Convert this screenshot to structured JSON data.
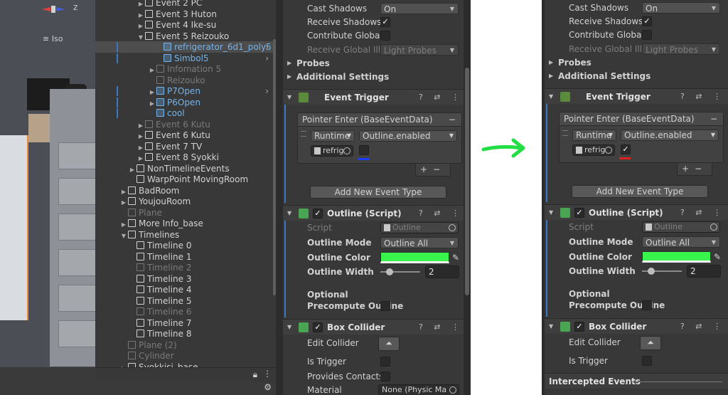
{
  "scene": {
    "gizmo_label": "z",
    "view_mode": "Iso"
  },
  "hierarchy": {
    "rows": [
      {
        "label": "Event 2 PC",
        "state": "normal"
      },
      {
        "label": "Event 3 Huton",
        "state": "normal"
      },
      {
        "label": "Event 4 Ike-su",
        "state": "normal"
      },
      {
        "label": "Event 5 Reizouko",
        "state": "normal"
      },
      {
        "label": "refrigerator_6d1_poly5",
        "state": "selected"
      },
      {
        "label": "Simbol5",
        "state": "blue"
      },
      {
        "label": "Infomation 5",
        "state": "dim"
      },
      {
        "label": "Reizouko",
        "state": "dim"
      },
      {
        "label": "P7Open",
        "state": "blue"
      },
      {
        "label": "P6Open",
        "state": "blue"
      },
      {
        "label": "cool",
        "state": "blue"
      },
      {
        "label": "Event 6 Kutu",
        "state": "dim"
      },
      {
        "label": "Event 6 Kutu",
        "state": "normal"
      },
      {
        "label": "Event 7 TV",
        "state": "normal"
      },
      {
        "label": "Event 8 Syokki",
        "state": "normal"
      },
      {
        "label": "NonTimelineEvents",
        "state": "normal"
      },
      {
        "label": "WarpPoint MovingRoom",
        "state": "normal"
      },
      {
        "label": "BadRoom",
        "state": "normal"
      },
      {
        "label": "YoujouRoom",
        "state": "normal"
      },
      {
        "label": "Plane",
        "state": "dim"
      },
      {
        "label": "More Info_base",
        "state": "normal"
      },
      {
        "label": "Timelines",
        "state": "normal"
      },
      {
        "label": "Timeline 0",
        "state": "normal"
      },
      {
        "label": "Timeline 1",
        "state": "normal"
      },
      {
        "label": "Timeline 2",
        "state": "dim"
      },
      {
        "label": "Timeline 3",
        "state": "normal"
      },
      {
        "label": "Timeline 4",
        "state": "normal"
      },
      {
        "label": "Timeline 5",
        "state": "normal"
      },
      {
        "label": "Timeline 6",
        "state": "dim"
      },
      {
        "label": "Timeline 7",
        "state": "normal"
      },
      {
        "label": "Timeline 8",
        "state": "normal"
      },
      {
        "label": "Plane (2)",
        "state": "dim"
      },
      {
        "label": "Cylinder",
        "state": "dim"
      },
      {
        "label": "Syokkisi_base",
        "state": "normal"
      }
    ]
  },
  "inspector_before": {
    "cast_shadows_label": "Cast Shadows",
    "cast_shadows_value": "On",
    "receive_shadows_label": "Receive Shadows",
    "contribute_global_label": "Contribute Global",
    "receive_gi_label": "Receive Global Ill",
    "receive_gi_value": "Light Probes",
    "probes_label": "Probes",
    "additional_label": "Additional Settings",
    "event_trigger_title": "Event Trigger",
    "pointer_enter_label": "Pointer Enter (BaseEventData)",
    "runtime_value": "Runtime",
    "function_value": "Outline.enabled",
    "object_value": "refrig",
    "add_event_label": "Add New Event Type",
    "outline_title": "Outline (Script)",
    "script_label": "Script",
    "script_value": "Outline",
    "mode_label": "Outline Mode",
    "mode_value": "Outline All",
    "color_label": "Outline Color",
    "width_label": "Outline Width",
    "width_value": "2",
    "optional_label": "Optional",
    "precompute_label": "Precompute Outline",
    "box_title": "Box Collider",
    "edit_collider_label": "Edit Collider",
    "is_trigger_label": "Is Trigger",
    "provides_contacts_label": "Provides Contacts",
    "material_label": "Material",
    "material_value": "None (Physic Ma",
    "plus": "+",
    "minus": "−",
    "remove_minus": "−",
    "arg_checked": false
  },
  "inspector_after": {
    "cast_shadows_label": "Cast Shadows",
    "cast_shadows_value": "On",
    "receive_shadows_label": "Receive Shadows",
    "contribute_global_label": "Contribute Global",
    "receive_gi_label": "Receive Global Ill",
    "receive_gi_value": "Light Probes",
    "probes_label": "Probes",
    "additional_label": "Additional Settings",
    "event_trigger_title": "Event Trigger",
    "pointer_enter_label": "Pointer Enter (BaseEventData)",
    "runtime_value": "Runtime",
    "function_value": "Outline.enabled",
    "object_value": "refrig",
    "add_event_label": "Add New Event Type",
    "outline_title": "Outline (Script)",
    "script_label": "Script",
    "script_value": "Outline",
    "mode_label": "Outline Mode",
    "mode_value": "Outline All",
    "color_label": "Outline Color",
    "width_label": "Outline Width",
    "width_value": "2",
    "optional_label": "Optional",
    "precompute_label": "Precompute Outline",
    "box_title": "Box Collider",
    "edit_collider_label": "Edit Collider",
    "is_trigger_label": "Is Trigger",
    "intercepted_label": "Intercepted Events",
    "plus": "+",
    "minus": "−",
    "remove_minus": "−",
    "arg_checked": true
  },
  "colors": {
    "outline_color": "#39f44d",
    "arrow_color": "#22dd44",
    "before_underline": "#1a3cff",
    "after_underline": "#e02020"
  }
}
